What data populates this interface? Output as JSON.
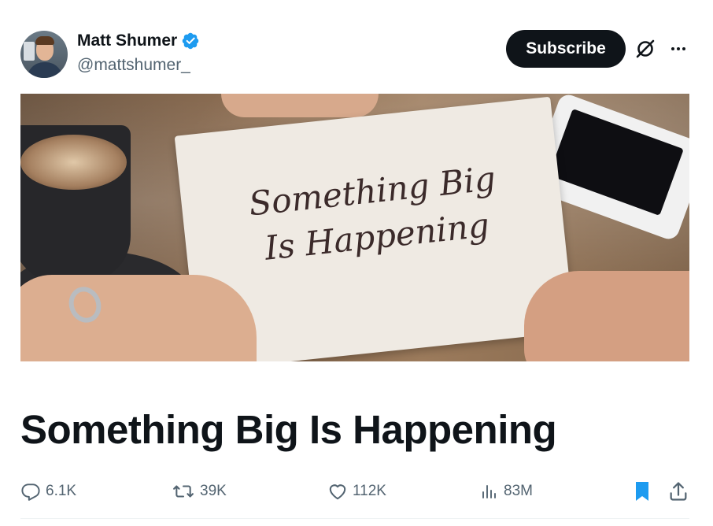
{
  "author": {
    "name": "Matt Shumer",
    "handle": "@mattshumer_",
    "verified": true
  },
  "header": {
    "subscribe_label": "Subscribe"
  },
  "image": {
    "card_line1": "Something Big",
    "card_line2": "Is Happening"
  },
  "article": {
    "title": "Something Big Is Happening"
  },
  "actions": {
    "replies": "6.1K",
    "reposts": "39K",
    "likes": "112K",
    "views": "83M"
  },
  "colors": {
    "accent": "#1d9bf0",
    "text_primary": "#0f1419",
    "text_secondary": "#536471",
    "button_bg": "#0f1419"
  },
  "icons": {
    "verified": "verified-badge-icon",
    "grok": "grok-icon",
    "more": "more-icon",
    "reply": "reply-icon",
    "repost": "repost-icon",
    "like": "heart-icon",
    "views": "views-icon",
    "bookmark": "bookmark-icon",
    "share": "share-icon"
  }
}
